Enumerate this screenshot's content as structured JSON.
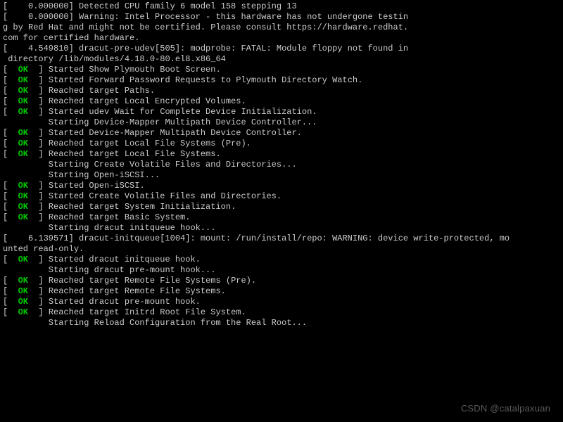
{
  "lines": [
    {
      "type": "plain",
      "text": "[    0.000000] Detected CPU family 6 model 158 stepping 13"
    },
    {
      "type": "plain",
      "text": "[    0.000000] Warning: Intel Processor - this hardware has not undergone testin"
    },
    {
      "type": "plain",
      "text": "g by Red Hat and might not be certified. Please consult https://hardware.redhat."
    },
    {
      "type": "plain",
      "text": "com for certified hardware."
    },
    {
      "type": "plain",
      "text": "[    4.549810] dracut-pre-udev[505]: modprobe: FATAL: Module floppy not found in"
    },
    {
      "type": "plain",
      "text": " directory /lib/modules/4.18.0-80.el8.x86_64"
    },
    {
      "type": "ok",
      "text": "Started Show Plymouth Boot Screen."
    },
    {
      "type": "ok",
      "text": "Started Forward Password Requests to Plymouth Directory Watch."
    },
    {
      "type": "ok",
      "text": "Reached target Paths."
    },
    {
      "type": "ok",
      "text": "Reached target Local Encrypted Volumes."
    },
    {
      "type": "ok",
      "text": "Started udev Wait for Complete Device Initialization."
    },
    {
      "type": "start",
      "text": "Starting Device-Mapper Multipath Device Controller..."
    },
    {
      "type": "ok",
      "text": "Started Device-Mapper Multipath Device Controller."
    },
    {
      "type": "ok",
      "text": "Reached target Local File Systems (Pre)."
    },
    {
      "type": "ok",
      "text": "Reached target Local File Systems."
    },
    {
      "type": "start",
      "text": "Starting Create Volatile Files and Directories..."
    },
    {
      "type": "start",
      "text": "Starting Open-iSCSI..."
    },
    {
      "type": "ok",
      "text": "Started Open-iSCSI."
    },
    {
      "type": "ok",
      "text": "Started Create Volatile Files and Directories."
    },
    {
      "type": "ok",
      "text": "Reached target System Initialization."
    },
    {
      "type": "ok",
      "text": "Reached target Basic System."
    },
    {
      "type": "start",
      "text": "Starting dracut initqueue hook..."
    },
    {
      "type": "plain",
      "text": "[    6.139571] dracut-initqueue[1004]: mount: /run/install/repo: WARNING: device write-protected, mo"
    },
    {
      "type": "plain",
      "text": "unted read-only."
    },
    {
      "type": "ok",
      "text": "Started dracut initqueue hook."
    },
    {
      "type": "start",
      "text": "Starting dracut pre-mount hook..."
    },
    {
      "type": "ok",
      "text": "Reached target Remote File Systems (Pre)."
    },
    {
      "type": "ok",
      "text": "Reached target Remote File Systems."
    },
    {
      "type": "ok",
      "text": "Started dracut pre-mount hook."
    },
    {
      "type": "ok",
      "text": "Reached target Initrd Root File System."
    },
    {
      "type": "start",
      "text": "Starting Reload Configuration from the Real Root..."
    }
  ],
  "status": {
    "ok_label": "OK",
    "prefix_open": "[  ",
    "prefix_close": "  ] ",
    "start_indent": "         "
  },
  "watermark": "CSDN @catalpaxuan"
}
